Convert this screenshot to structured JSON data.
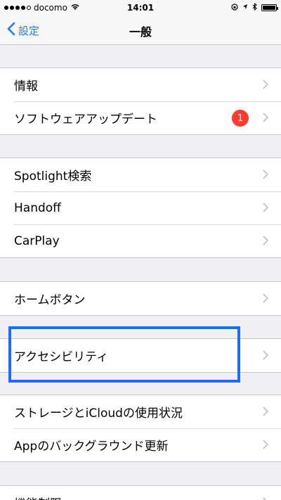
{
  "status_bar": {
    "carrier": "docomo",
    "time": "14:01"
  },
  "nav": {
    "back_label": "設定",
    "title": "一般"
  },
  "groups": [
    {
      "rows": [
        {
          "label": "情報"
        },
        {
          "label": "ソフトウェアアップデート",
          "badge": "1"
        }
      ]
    },
    {
      "rows": [
        {
          "label": "Spotlight検索"
        },
        {
          "label": "Handoff"
        },
        {
          "label": "CarPlay"
        }
      ]
    },
    {
      "rows": [
        {
          "label": "ホームボタン"
        }
      ]
    },
    {
      "rows": [
        {
          "label": "アクセシビリティ"
        }
      ]
    },
    {
      "rows": [
        {
          "label": "ストレージとiCloudの使用状況"
        },
        {
          "label": "Appのバックグラウンド更新"
        }
      ]
    },
    {
      "rows": [
        {
          "label": "機能制限"
        }
      ]
    }
  ],
  "colors": {
    "accent": "#1a7cf5",
    "badge": "#ff3b30",
    "highlight": "#1a6ef5",
    "background": "#efeff4"
  },
  "icons": {
    "back": "chevron-left-icon",
    "disclosure": "chevron-right-icon",
    "wifi": "wifi-icon",
    "bluetooth": "bluetooth-icon",
    "battery": "battery-icon"
  }
}
